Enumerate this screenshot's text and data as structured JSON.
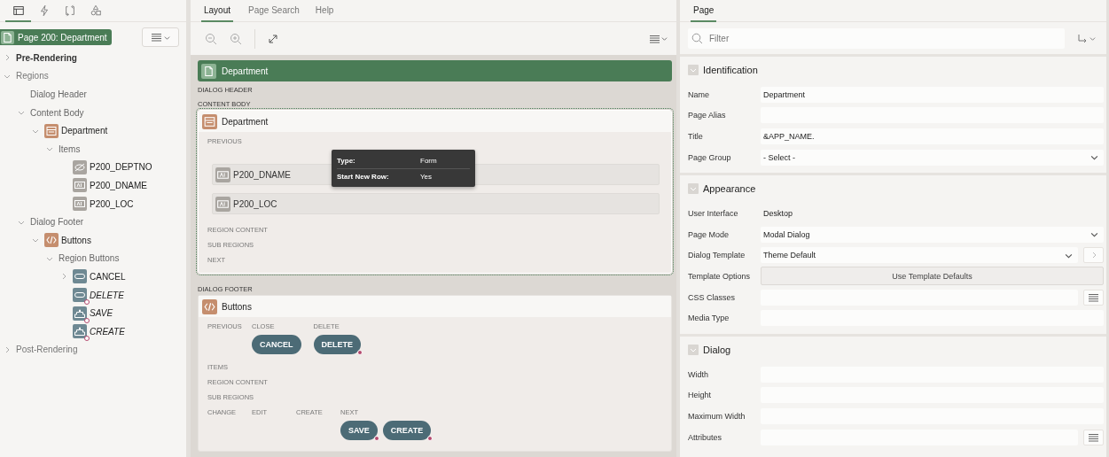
{
  "left_tabs": [
    {
      "selected": true
    },
    {
      "selected": false
    },
    {
      "selected": false
    },
    {
      "selected": false
    }
  ],
  "tree": {
    "root": "Page 200: Department",
    "nodes": [
      {
        "label": "Pre-Rendering",
        "expanded": false,
        "bold": true
      },
      {
        "label": "Regions",
        "expanded": true,
        "bold": false,
        "children": [
          {
            "label": "Dialog Header"
          },
          {
            "label": "Content Body",
            "expanded": true,
            "children": [
              {
                "label": "Department",
                "kind": "region",
                "expanded": true,
                "children": [
                  {
                    "label": "Items",
                    "expanded": true,
                    "children": [
                      {
                        "label": "P200_DEPTNO",
                        "kind": "hidden-item",
                        "conditional": false
                      },
                      {
                        "label": "P200_DNAME",
                        "kind": "text-item",
                        "conditional": false
                      },
                      {
                        "label": "P200_LOC",
                        "kind": "text-item",
                        "conditional": false
                      }
                    ]
                  }
                ]
              }
            ]
          },
          {
            "label": "Dialog Footer",
            "expanded": true,
            "children": [
              {
                "label": "Buttons",
                "kind": "static",
                "expanded": true,
                "children": [
                  {
                    "label": "Region Buttons",
                    "expanded": true,
                    "children": [
                      {
                        "label": "CANCEL",
                        "kind": "button",
                        "expanded": false,
                        "conditional": false
                      },
                      {
                        "label": "DELETE",
                        "kind": "button",
                        "conditional": true
                      },
                      {
                        "label": "SAVE",
                        "kind": "submit",
                        "conditional": true
                      },
                      {
                        "label": "CREATE",
                        "kind": "submit",
                        "conditional": true
                      }
                    ]
                  }
                ]
              }
            ]
          }
        ]
      },
      {
        "label": "Post-Rendering",
        "expanded": false,
        "bold": false
      }
    ]
  },
  "middle_tabs": [
    {
      "label": "Layout",
      "selected": true
    },
    {
      "label": "Page Search",
      "selected": false
    },
    {
      "label": "Help",
      "selected": false
    }
  ],
  "canvas": {
    "page_title": "Department",
    "sections": [
      {
        "label": "DIALOG HEADER"
      },
      {
        "label": "CONTENT BODY",
        "region": {
          "title": "Department",
          "kind": "region",
          "selected": true,
          "rows": [
            {
              "kind": "label",
              "label": "PREVIOUS"
            },
            {
              "kind": "item",
              "label": "P200_DNAME"
            },
            {
              "kind": "item",
              "label": "P200_LOC"
            },
            {
              "kind": "label",
              "label": "REGION CONTENT"
            },
            {
              "kind": "label",
              "label": "SUB REGIONS"
            },
            {
              "kind": "label",
              "label": "NEXT"
            }
          ],
          "tooltip": [
            {
              "label": "Type:",
              "value": "Form"
            },
            {
              "label": "Start New Row:",
              "value": "Yes"
            }
          ]
        }
      },
      {
        "label": "DIALOG FOOTER",
        "region": {
          "title": "Buttons",
          "kind": "static",
          "selected": false,
          "rows": [
            {
              "kind": "slots",
              "slots": [
                {
                  "label": "PREVIOUS"
                },
                {
                  "label": "CLOSE",
                  "buttons": [
                    {
                      "label": "CANCEL",
                      "conditional": false
                    }
                  ]
                },
                {
                  "label": "DELETE",
                  "buttons": [
                    {
                      "label": "DELETE",
                      "conditional": true
                    }
                  ]
                }
              ]
            },
            {
              "kind": "label",
              "label": "ITEMS"
            },
            {
              "kind": "label",
              "label": "REGION CONTENT"
            },
            {
              "kind": "label",
              "label": "SUB REGIONS"
            },
            {
              "kind": "slots",
              "slots": [
                {
                  "label": "CHANGE"
                },
                {
                  "label": "EDIT"
                },
                {
                  "label": "CREATE"
                },
                {
                  "label": "NEXT",
                  "buttons": [
                    {
                      "label": "SAVE",
                      "conditional": true
                    },
                    {
                      "label": "CREATE",
                      "conditional": true
                    }
                  ]
                }
              ]
            }
          ]
        }
      }
    ]
  },
  "right_tabs": [
    {
      "label": "Page",
      "selected": true
    }
  ],
  "filter": {
    "placeholder": "Filter"
  },
  "groups": [
    {
      "title": "Identification",
      "expanded": true,
      "fields": [
        {
          "label": "Name",
          "kind": "text",
          "value": "Department"
        },
        {
          "label": "Page Alias",
          "kind": "text"
        },
        {
          "label": "Title",
          "kind": "text",
          "value": "&APP_NAME."
        },
        {
          "label": "Page Group",
          "kind": "select",
          "value": "- Select -"
        }
      ]
    },
    {
      "title": "Appearance",
      "expanded": true,
      "fields": [
        {
          "label": "User Interface",
          "kind": "static",
          "value": "Desktop"
        },
        {
          "label": "Page Mode",
          "kind": "select",
          "value": "Modal Dialog"
        },
        {
          "label": "Dialog Template",
          "kind": "select",
          "value": "Theme Default",
          "link": true
        },
        {
          "label": "Template Options",
          "kind": "button",
          "value": "Use Template Defaults"
        },
        {
          "label": "CSS Classes",
          "kind": "text",
          "picker": true
        },
        {
          "label": "Media Type",
          "kind": "text"
        }
      ]
    },
    {
      "title": "Dialog",
      "expanded": true,
      "fields": [
        {
          "label": "Width",
          "kind": "text"
        },
        {
          "label": "Height",
          "kind": "text"
        },
        {
          "label": "Maximum Width",
          "kind": "text"
        },
        {
          "label": "Attributes",
          "kind": "text",
          "picker": true
        }
      ]
    }
  ]
}
